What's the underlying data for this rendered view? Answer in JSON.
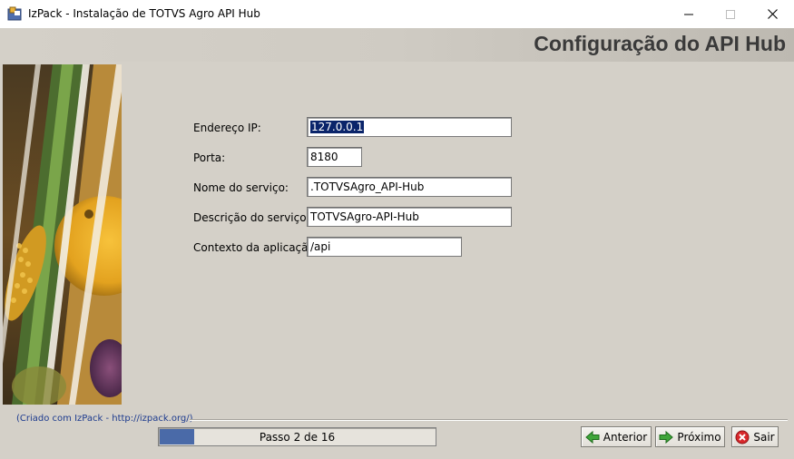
{
  "window": {
    "title": "IzPack - Instalação de TOTVS Agro API Hub",
    "controls": {
      "minimize": "minimize-icon",
      "maximize": "maximize-icon",
      "close": "close-icon"
    }
  },
  "header": {
    "heading": "Configuração do API Hub"
  },
  "form": {
    "fields": [
      {
        "label": "Endereço IP:",
        "value": "127.0.0.1",
        "selected": true
      },
      {
        "label": "Porta:",
        "value": "8180"
      },
      {
        "label": "Nome do serviço:",
        "value": ".TOTVSAgro_API-Hub"
      },
      {
        "label": "Descrição do serviço:",
        "value": "TOTVSAgro-API-Hub"
      },
      {
        "label": "Contexto da aplicação:",
        "value": "/api"
      }
    ]
  },
  "footer": {
    "credit": "(Criado com IzPack - http://izpack.org/)",
    "progress": {
      "text": "Passo 2 de 16",
      "current": 2,
      "total": 16
    },
    "buttons": {
      "previous": {
        "label": "Anterior",
        "icon": "arrow-left-icon"
      },
      "next": {
        "label": "Próximo",
        "icon": "arrow-right-icon"
      },
      "quit": {
        "label": "Sair",
        "icon": "stop-icon"
      }
    }
  },
  "colors": {
    "background": "#d4d0c8",
    "progress_fill": "#4a6aa8",
    "selection": "#0a246a",
    "credit_link": "#1c3a8e"
  }
}
